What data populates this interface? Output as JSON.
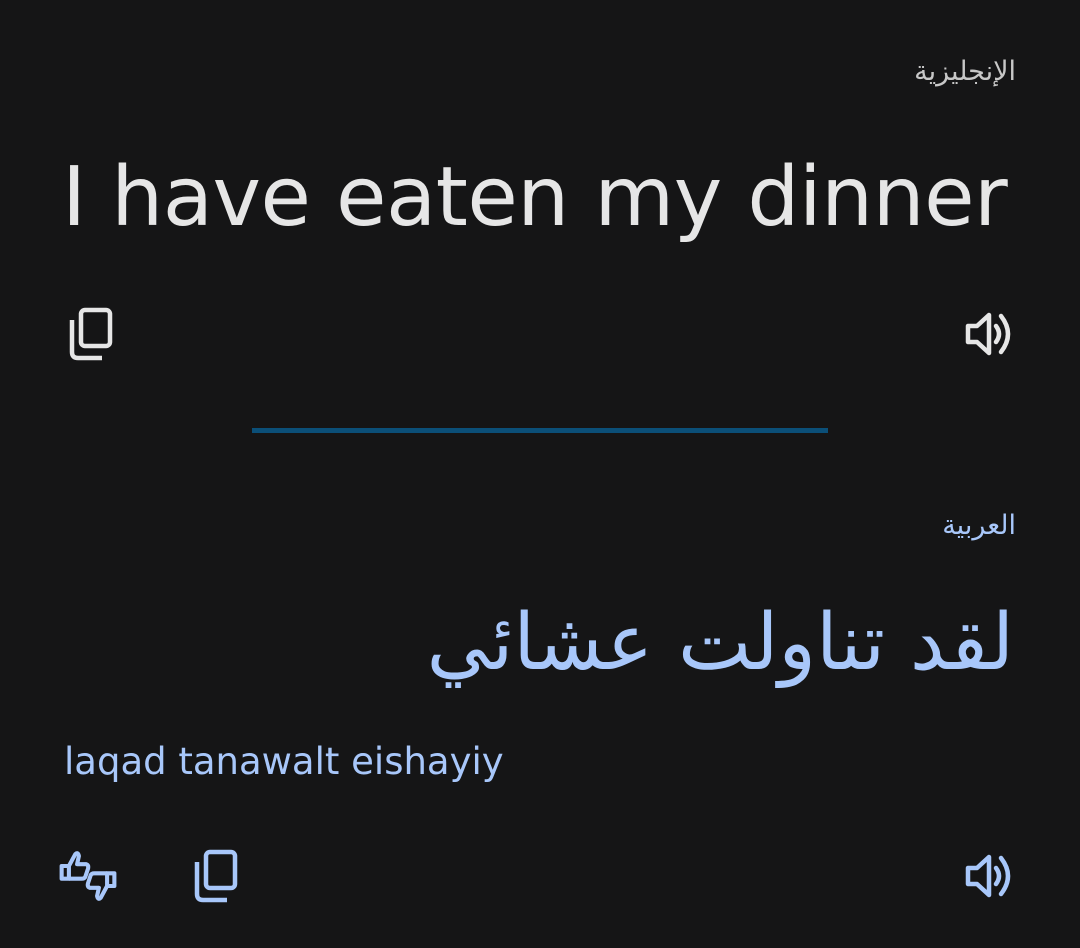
{
  "source": {
    "language": "الإنجليزية",
    "text": "I have eaten my dinner",
    "copy_icon": "copy-icon",
    "speak_icon": "speaker-icon"
  },
  "target": {
    "language": "العربية",
    "text": "لقد تناولت عشائي",
    "transliteration": "laqad tanawalt eishayiy",
    "feedback_icon": "thumbs-up-down-icon",
    "copy_icon": "copy-icon",
    "speak_icon": "speaker-icon"
  },
  "colors": {
    "background": "#151516",
    "source_text": "#e6e6e6",
    "source_label": "#c7c7c7",
    "accent": "#a8c7fa",
    "divider": "#0b4f78"
  }
}
